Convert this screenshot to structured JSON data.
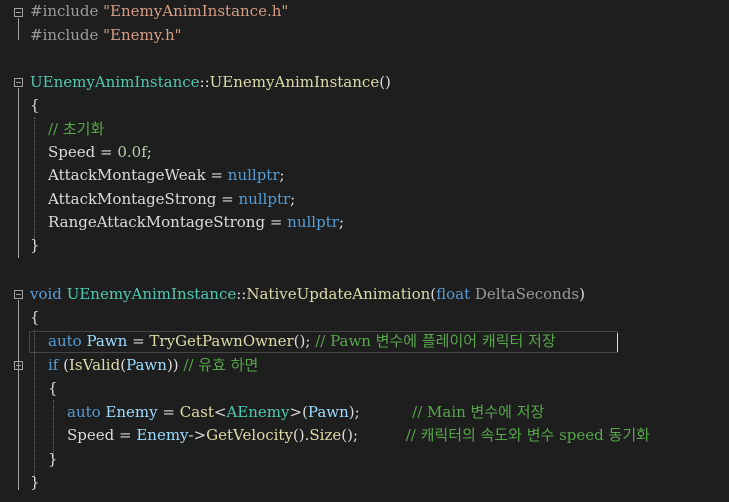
{
  "code": {
    "l1": {
      "pp": "#include",
      "str": "\"EnemyAnimInstance.h\""
    },
    "l2": {
      "pp": "#include",
      "str": "\"Enemy.h\""
    },
    "l4": {
      "cls": "UEnemyAnimInstance",
      "sep": "::",
      "fn": "UEnemyAnimInstance",
      "rest": "()"
    },
    "l5": {
      "text": "{"
    },
    "l6": {
      "cmt": "// 초기화"
    },
    "l7": {
      "a": "Speed",
      "b": " = ",
      "num": "0.0f",
      "c": ";"
    },
    "l8": {
      "a": "AttackMontageWeak",
      "b": " = ",
      "kw": "nullptr",
      "c": ";"
    },
    "l9": {
      "a": "AttackMontageStrong",
      "b": " = ",
      "kw": "nullptr",
      "c": ";"
    },
    "l10": {
      "a": "RangeAttackMontageStrong",
      "b": " = ",
      "kw": "nullptr",
      "c": ";"
    },
    "l11": {
      "text": "}"
    },
    "l13": {
      "kw": "void",
      "sp": " ",
      "cls": "UEnemyAnimInstance",
      "sep": "::",
      "fn": "NativeUpdateAnimation",
      "p1": "(",
      "kw2": "float",
      "param": " DeltaSeconds",
      "p2": ")"
    },
    "l14": {
      "text": "{"
    },
    "l15": {
      "kw": "auto",
      "var": " Pawn",
      "b": " = ",
      "fn": "TryGetPawnOwner",
      "c": "(); ",
      "cmt": "// Pawn 변수에 플레이어 캐릭터 저장"
    },
    "l16": {
      "kw": "if",
      "a": " (",
      "fn": "IsValid",
      "b": "(",
      "var": "Pawn",
      "c": ")) ",
      "cmt": "// 유효 하면"
    },
    "l17": {
      "text": "{"
    },
    "l18": {
      "kw": "auto",
      "var": " Enemy",
      "b": " = ",
      "fn": "Cast",
      "lt": "<",
      "cls": "AEnemy",
      "gt": ">(",
      "var2": "Pawn",
      "c": ");",
      "gap": "           ",
      "cmt": "// Main 변수에 저장"
    },
    "l19": {
      "a": "Speed",
      "b": " = ",
      "var": "Enemy",
      "arr": "->",
      "fn": "GetVelocity",
      "c": "().",
      "fn2": "Size",
      "d": "();",
      "gap": "          ",
      "cmt": "// 캐릭터의 속도와 변수 speed 동기화"
    },
    "l20": {
      "text": "}"
    },
    "l21": {
      "text": "}"
    }
  }
}
